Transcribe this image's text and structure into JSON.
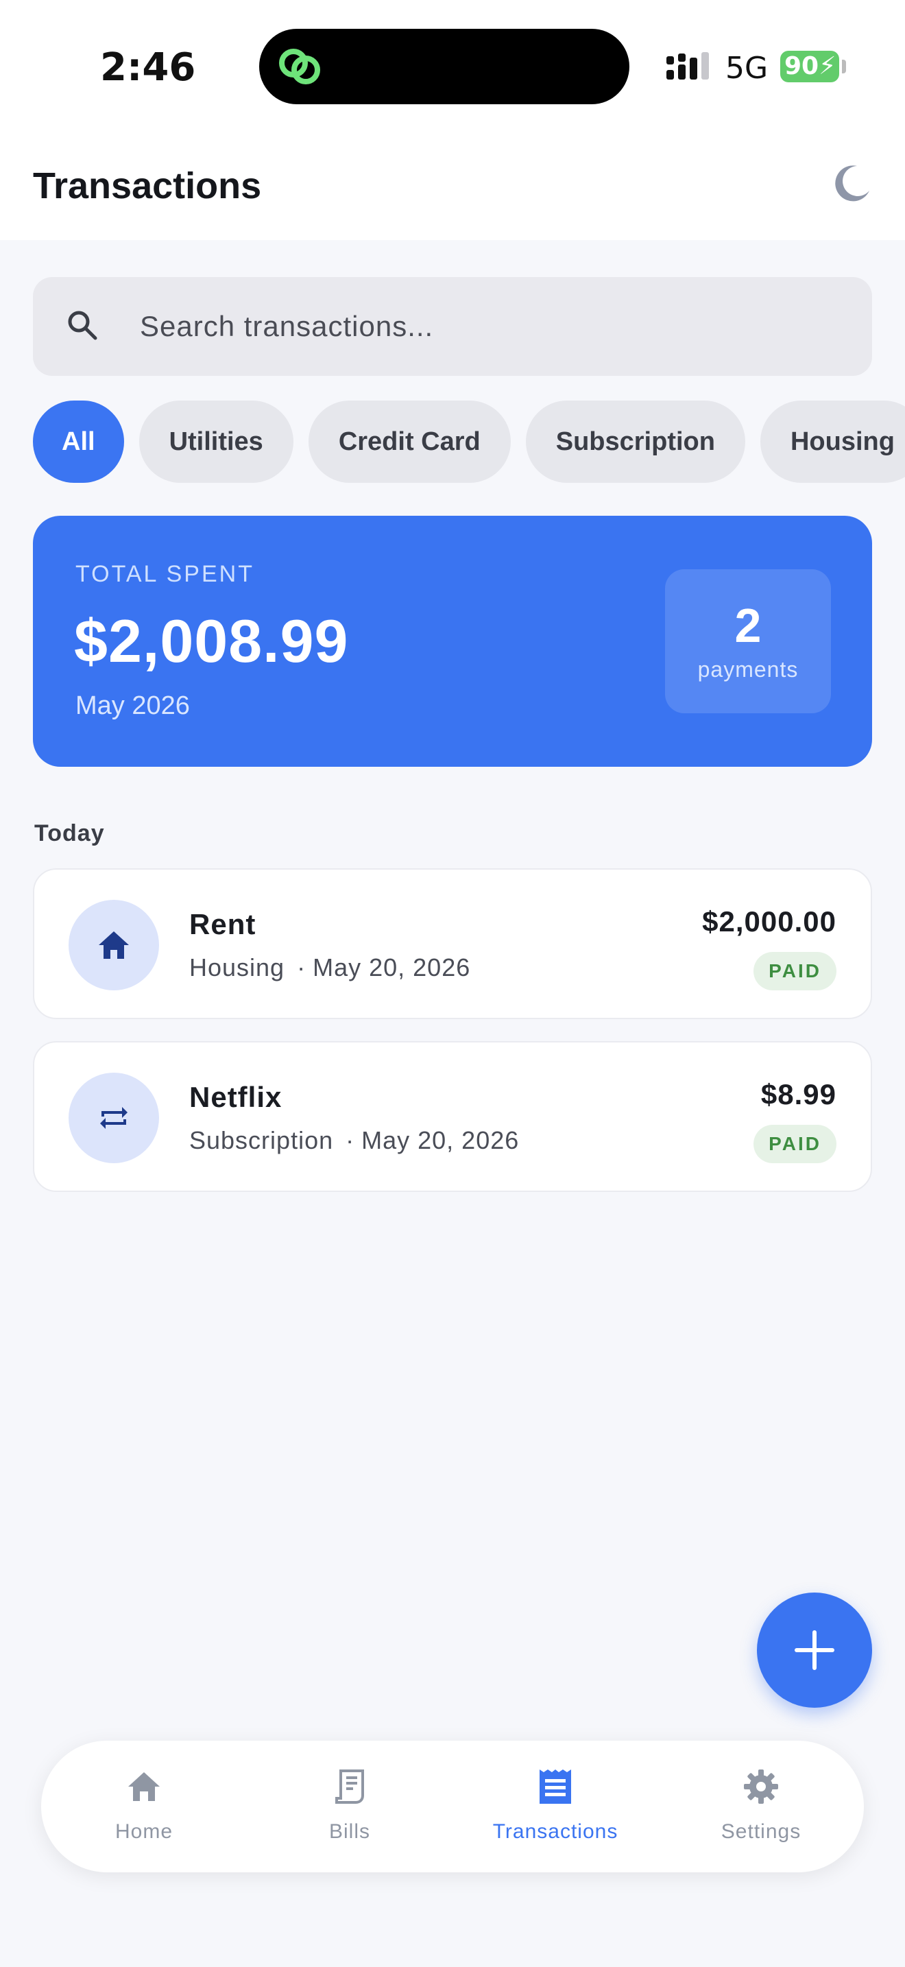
{
  "status_bar": {
    "time": "2:46",
    "network": "5G",
    "battery": "90"
  },
  "header": {
    "title": "Transactions",
    "theme_icon": "moon-icon"
  },
  "search": {
    "placeholder": "Search transactions..."
  },
  "filters": [
    {
      "label": "All",
      "active": true
    },
    {
      "label": "Utilities",
      "active": false
    },
    {
      "label": "Credit Card",
      "active": false
    },
    {
      "label": "Subscription",
      "active": false
    },
    {
      "label": "Housing",
      "active": false
    }
  ],
  "summary": {
    "label": "TOTAL SPENT",
    "amount": "$2,008.99",
    "period": "May 2026",
    "count": "2",
    "count_label": "payments"
  },
  "section": {
    "label": "Today"
  },
  "transactions": [
    {
      "name": "Rent",
      "category": "Housing",
      "date": "May 20, 2026",
      "amount": "$2,000.00",
      "status": "PAID",
      "icon": "home-icon"
    },
    {
      "name": "Netflix",
      "category": "Subscription",
      "date": "May 20, 2026",
      "amount": "$8.99",
      "status": "PAID",
      "icon": "repeat-icon"
    }
  ],
  "nav": {
    "items": [
      {
        "label": "Home",
        "icon": "home-icon"
      },
      {
        "label": "Bills",
        "icon": "receipt-icon"
      },
      {
        "label": "Transactions",
        "icon": "list-icon",
        "active": true
      },
      {
        "label": "Settings",
        "icon": "gear-icon"
      }
    ]
  },
  "colors": {
    "accent": "#3A74F1",
    "background": "#F6F7FB",
    "paid_text": "#3E8E41",
    "paid_bg": "#E6F2E6"
  }
}
